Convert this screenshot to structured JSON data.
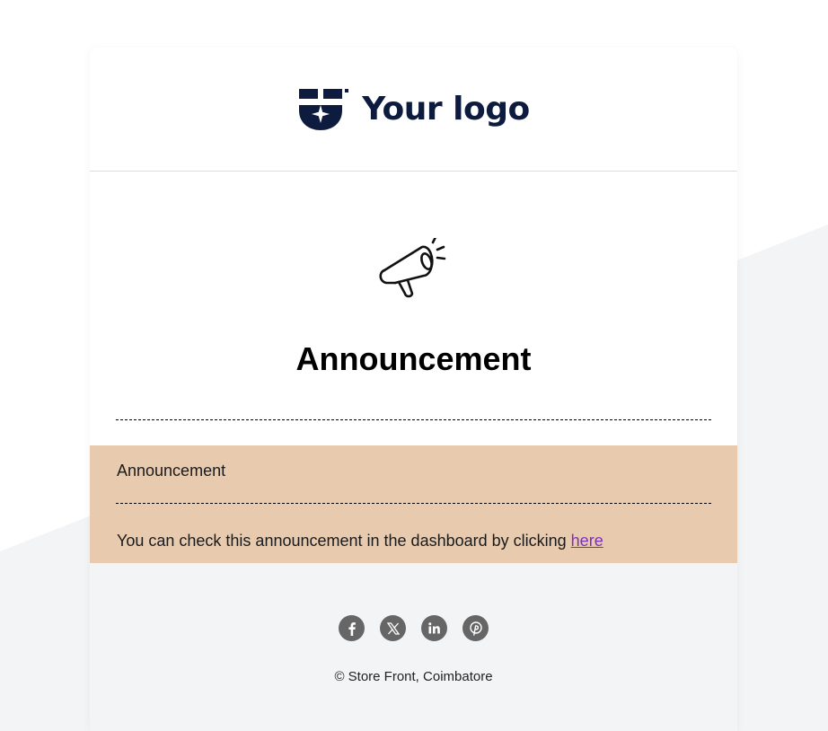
{
  "header": {
    "logo_text": "Your logo",
    "logo_icon": "shield-star-icon",
    "brand_color": "#0d1b3e"
  },
  "hero": {
    "icon": "megaphone-icon",
    "title": "Announcement"
  },
  "notice": {
    "heading": "Announcement",
    "body_text": "You can check this announcement in the dashboard by clicking ",
    "link_text": "here",
    "background_color": "#e8cbaf",
    "link_color": "#7b2fbe"
  },
  "footer": {
    "social": [
      {
        "name": "facebook",
        "icon": "facebook-icon"
      },
      {
        "name": "x",
        "icon": "x-twitter-icon"
      },
      {
        "name": "linkedin",
        "icon": "linkedin-icon"
      },
      {
        "name": "pinterest",
        "icon": "pinterest-icon"
      }
    ],
    "copyright": "© Store Front, Coimbatore",
    "background_color": "#f3f4f6"
  }
}
